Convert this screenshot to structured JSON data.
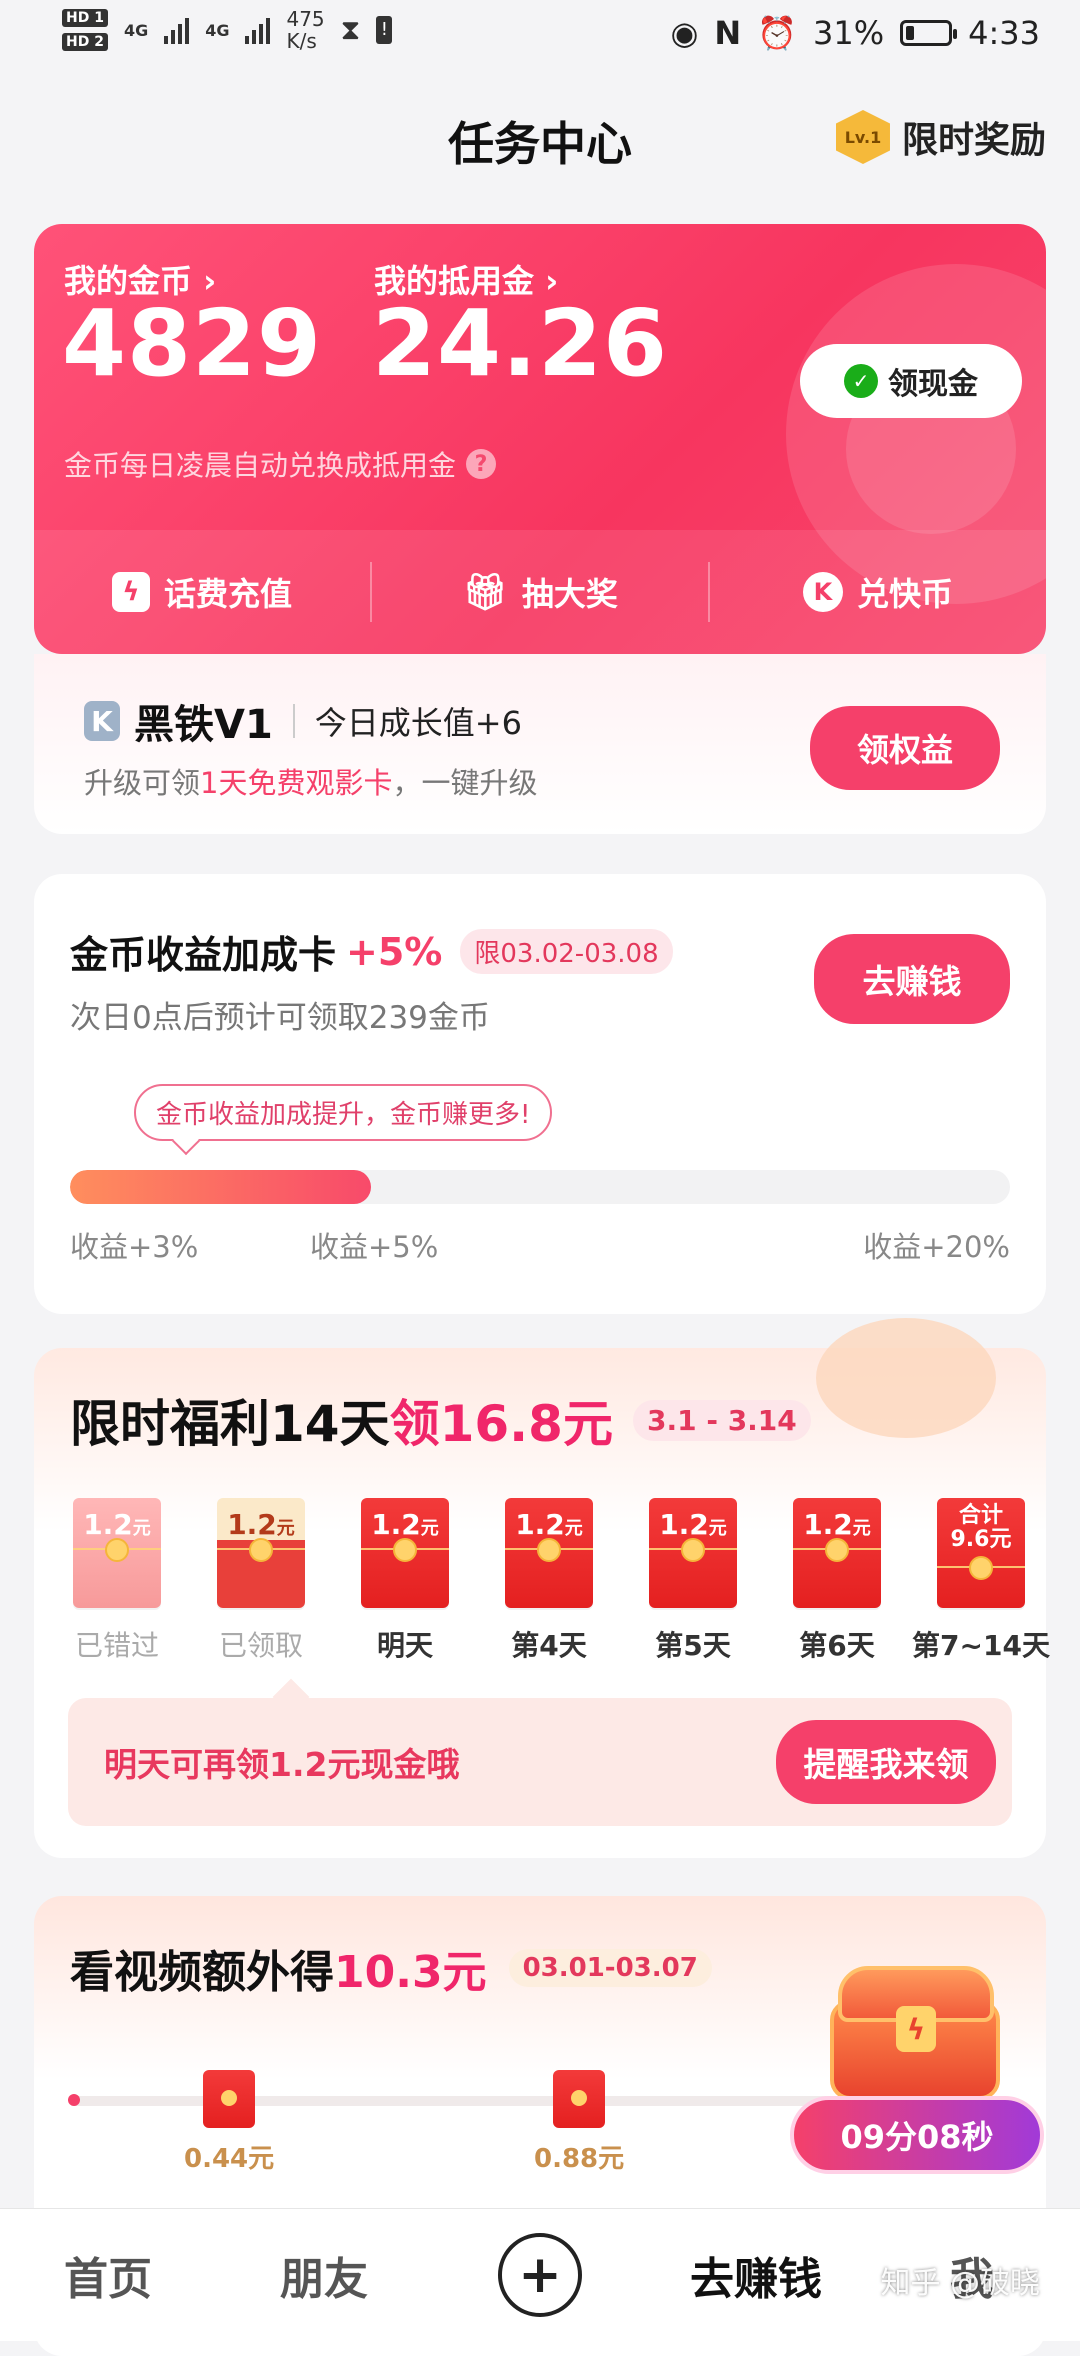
{
  "status_bar": {
    "hd1": "HD 1",
    "hd2": "HD 2",
    "net1": "4G",
    "net2": "4G",
    "speed_value": "475",
    "speed_unit": "K/s",
    "battery_percent": "31%",
    "battery_level": 0.31,
    "time": "4:33"
  },
  "header": {
    "title": "任务中心",
    "level_badge": "Lv.1",
    "limited_reward": "限时奖励"
  },
  "coin_card": {
    "coins_label": "我的金币 ›",
    "coins_value": "4829",
    "voucher_label": "我的抵用金 ›",
    "voucher_value": "24.26",
    "cash_button": "领现金",
    "note": "金币每日凌晨自动兑换成抵用金",
    "actions": [
      {
        "label": "话费充值",
        "icon": "lightning-icon"
      },
      {
        "label": "抽大奖",
        "icon": "gift-icon"
      },
      {
        "label": "兑快币",
        "icon": "k-coin-icon"
      }
    ]
  },
  "vip": {
    "name": "黑铁V1",
    "growth": "今日成长值+6",
    "sub_prefix": "升级可领",
    "sub_highlight": "1天免费观影卡",
    "sub_suffix": "，一键升级",
    "button": "领权益"
  },
  "boost": {
    "title": "金币收益加成卡",
    "pct": "+5%",
    "date_tag": "限03.02-03.08",
    "sub": "次日0点后预计可领取239金币",
    "button": "去赚钱",
    "bubble": "金币收益加成提升，金币赚更多!",
    "progress": 0.32,
    "ticks": [
      "收益+3%",
      "收益+5%",
      "收益+20%"
    ]
  },
  "welfare": {
    "title_prefix": "限时福利14天",
    "title_amount": "领16.8元",
    "date_tag": "3.1 - 3.14",
    "days": [
      {
        "amount": "1.2",
        "unit": "元",
        "label": "已错过",
        "state": "missed"
      },
      {
        "amount": "1.2",
        "unit": "元",
        "label": "已领取",
        "state": "claimed"
      },
      {
        "amount": "1.2",
        "unit": "元",
        "label": "明天",
        "state": "normal"
      },
      {
        "amount": "1.2",
        "unit": "元",
        "label": "第4天",
        "state": "normal"
      },
      {
        "amount": "1.2",
        "unit": "元",
        "label": "第5天",
        "state": "normal"
      },
      {
        "amount": "1.2",
        "unit": "元",
        "label": "第6天",
        "state": "normal"
      },
      {
        "amount": "合计",
        "unit": "9.6元",
        "label": "第7~14天",
        "state": "total"
      }
    ],
    "message": "明天可再领1.2元现金哦",
    "button": "提醒我来领"
  },
  "video": {
    "title_prefix": "看视频额外得",
    "title_amount": "10.3元",
    "date_tag": "03.01-03.07",
    "rewards": [
      "0.44元",
      "0.88元"
    ],
    "timer": "09分08秒"
  },
  "bottom_nav": {
    "home": "首页",
    "friends": "朋友",
    "plus": "+",
    "earn": "去赚钱",
    "me": "我"
  },
  "watermark": "知乎 @破晓",
  "colors": {
    "accent": "#f5406a",
    "card_red": "#f7355f",
    "background": "#f4f4f6"
  }
}
